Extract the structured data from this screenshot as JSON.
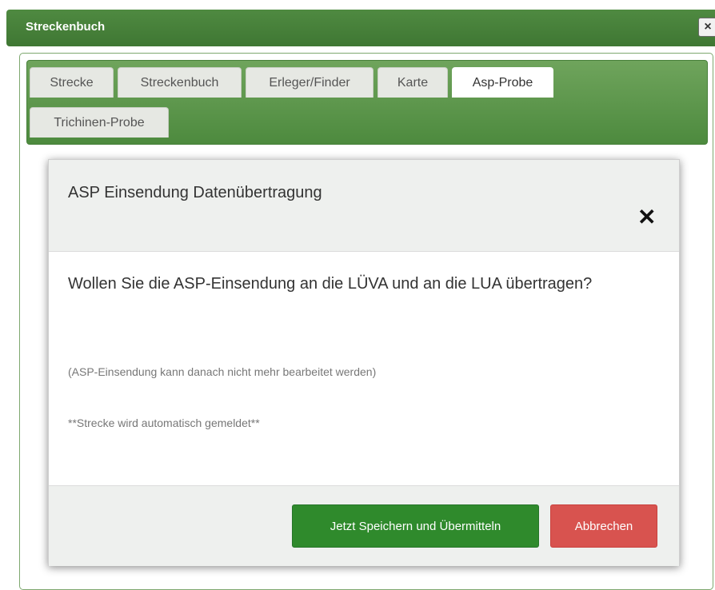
{
  "window": {
    "title": "Streckenbuch",
    "close_glyph": "×"
  },
  "tabs": [
    {
      "label": "Strecke",
      "active": false
    },
    {
      "label": "Streckenbuch",
      "active": false
    },
    {
      "label": "Erleger/Finder",
      "active": false
    },
    {
      "label": "Karte",
      "active": false
    },
    {
      "label": "Asp-Probe",
      "active": true
    },
    {
      "label": "Trichinen-Probe",
      "active": false
    }
  ],
  "modal": {
    "title": "ASP Einsendung Datenübertragung",
    "close_glyph": "✕",
    "question": "Wollen Sie die ASP-Einsendung an die LÜVA und an die LUA übertragen?",
    "note1": "(ASP-Einsendung kann danach nicht mehr bearbeitet werden)",
    "note2": "**Strecke wird automatisch gemeldet**",
    "save_label": "Jetzt Speichern und Übermitteln",
    "cancel_label": "Abbrechen"
  },
  "colors": {
    "header_green": "#4f8a41",
    "tabbar_green": "#5e9a4e",
    "save_button": "#2f8a2c",
    "cancel_button": "#d8534f"
  }
}
